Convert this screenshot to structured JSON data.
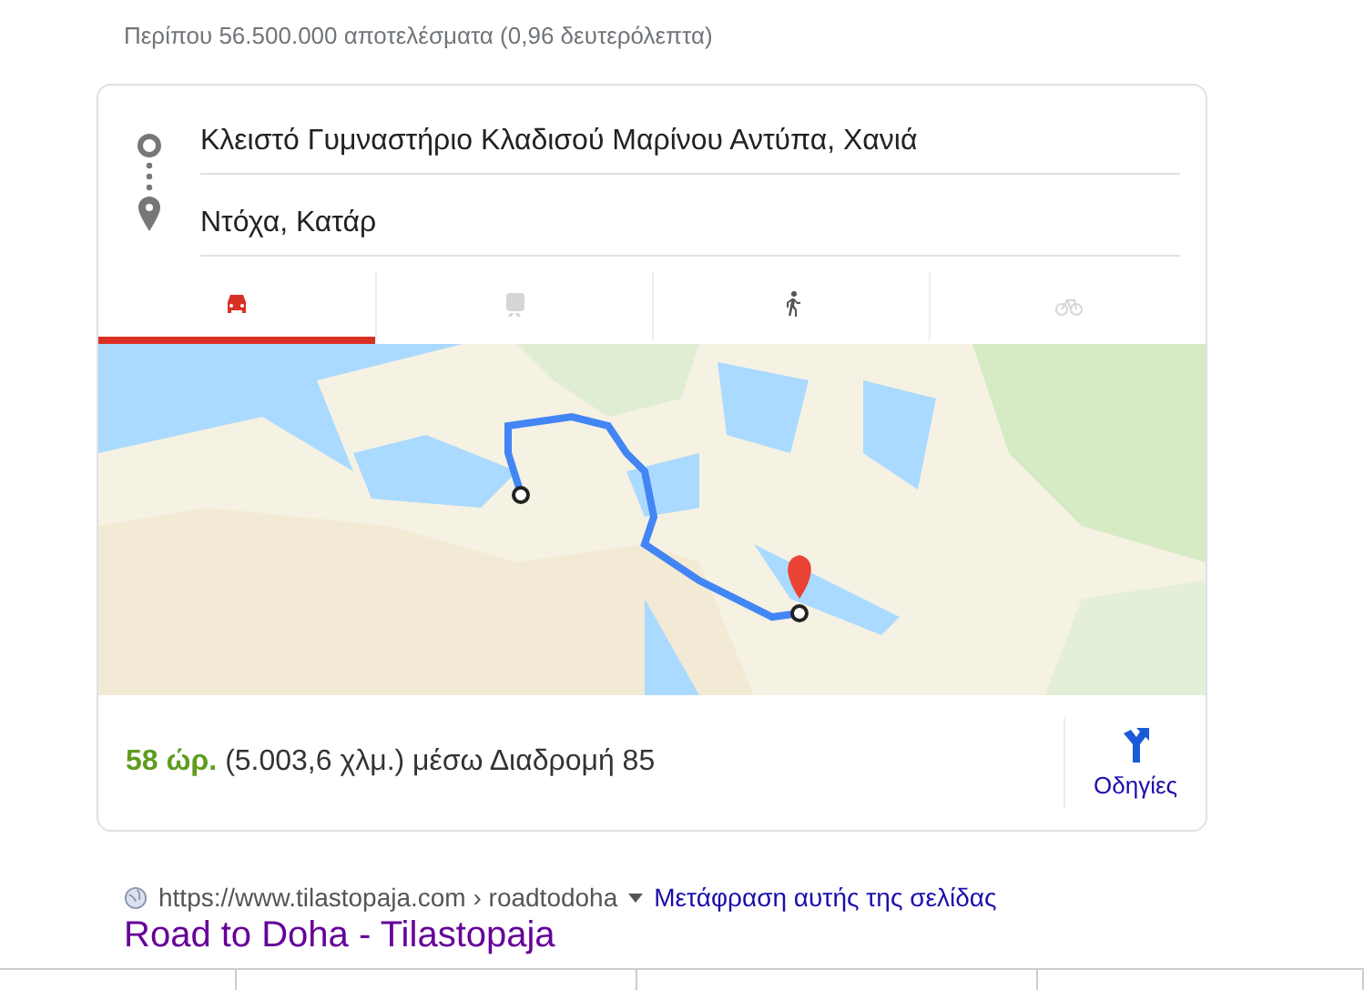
{
  "result_stats": "Περίπου 56.500.000 αποτελέσματα (0,96 δευτερόλεπτα)",
  "directions": {
    "origin": "Κλειστό Γυμναστήριο Κλαδισού Μαρίνου Αντύπα, Χανιά",
    "destination": "Ντόχα, Κατάρ",
    "modes": [
      {
        "kind": "car",
        "selected": true,
        "disabled": false
      },
      {
        "kind": "transit",
        "selected": false,
        "disabled": true
      },
      {
        "kind": "walk",
        "selected": false,
        "disabled": false
      },
      {
        "kind": "bike",
        "selected": false,
        "disabled": true
      }
    ],
    "duration": "58 ώρ.",
    "summary": "(5.003,6 χλμ.) μέσω Διαδρομή 85",
    "directions_button": "Οδηγίες"
  },
  "result": {
    "url": "https://www.tilastopaja.com › roadtodoha",
    "translate": "Μετάφραση αυτής της σελίδας",
    "title": "Road to Doha - Tilastopaja"
  }
}
